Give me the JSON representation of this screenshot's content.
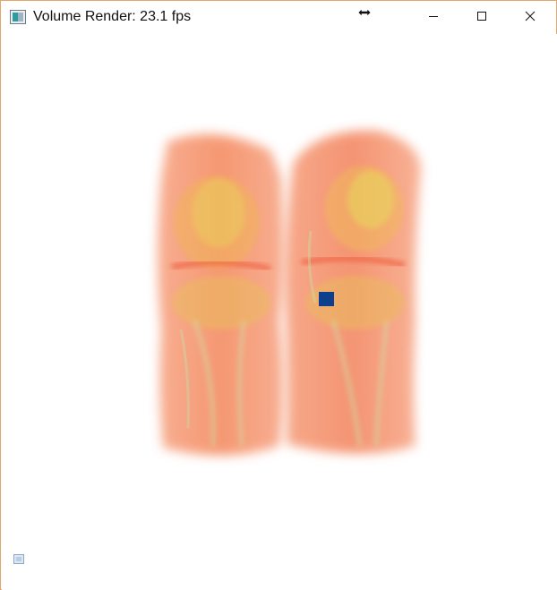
{
  "window": {
    "title": "Volume Render: 23.1 fps",
    "controls": {
      "minimize_icon": "minimize-icon",
      "maximize_icon": "maximize-icon",
      "close_icon": "close-icon"
    },
    "border_color": "#e3a66b"
  },
  "viewport": {
    "background": "#ffffff",
    "render": "knee-volume-render",
    "marker_color": "#0d3f8c",
    "corner_widget": "orientation-widget"
  }
}
